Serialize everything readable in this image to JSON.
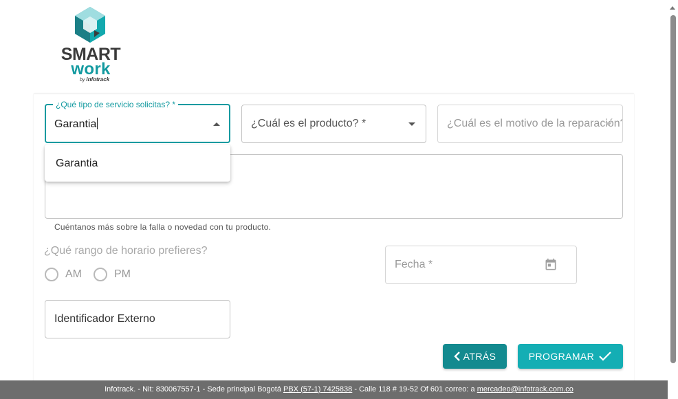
{
  "brand": {
    "name_line1": "SMART",
    "name_line2": "work",
    "by_prefix": "by",
    "by_company": "infotrack",
    "color_primary": "#139aa0",
    "color_dark": "#3b3b3b"
  },
  "form": {
    "service_type": {
      "label": "¿Qué tipo de servicio solicitas? *",
      "value": "Garantia",
      "options": [
        "Garantia"
      ]
    },
    "product": {
      "placeholder": "¿Cuál es el producto? *"
    },
    "repair_reason": {
      "placeholder": "¿Cuál es el motivo de la reparación? *"
    },
    "description": {
      "value": "",
      "helper": "Cuéntanos más sobre la falla o novedad con tu producto."
    },
    "schedule": {
      "question": "¿Qué rango de horario prefieres?",
      "options": [
        "AM",
        "PM"
      ]
    },
    "date": {
      "placeholder": "Fecha *"
    },
    "external_id": {
      "placeholder": "Identificador Externo"
    },
    "buttons": {
      "back": "ATRÁS",
      "submit": "PROGRAMAR"
    }
  },
  "footer": {
    "text_before": "Infotrack. - Nit: 830067557-1 - Sede principal Bogotá ",
    "phone": "PBX (57-1) 7425838",
    "address": " - Calle 118 # 19-52 Of 601   correo: a ",
    "email": "mercadeo@infotrack.com.co"
  }
}
